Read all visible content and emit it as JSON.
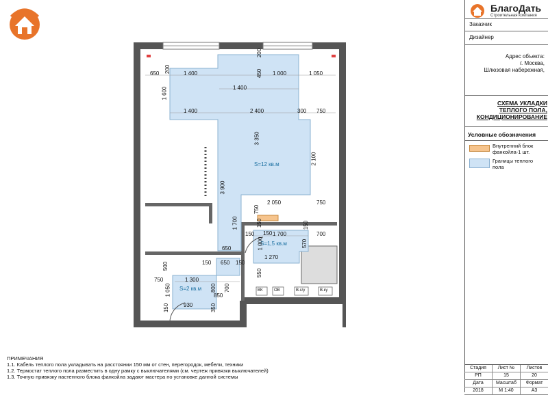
{
  "brand": {
    "name": "БлагоДать",
    "subtitle": "Строительная компания"
  },
  "title_block": {
    "customer_label": "Заказчик",
    "designer_label": "Дизайнер",
    "address": [
      "Адрес объекта:",
      "г. Москва,",
      "Шлюзовая набережная,"
    ],
    "sheet_title": [
      "СХЕМА УКЛАДКИ",
      "ТЕПЛОГО ПОЛА,",
      "КОНДИЦИОНИРОВАНИЕ"
    ],
    "legend_title": "Условные обозначения",
    "legend": [
      {
        "text": [
          "Внутренний блок",
          "фанкойла-1 шт."
        ],
        "color": "#f6c48d"
      },
      {
        "text": [
          "Границы теплого",
          "пола"
        ],
        "color": "#cfe3f5"
      }
    ]
  },
  "stamp": {
    "headers": [
      "Стадия",
      "Лист №",
      "Листов"
    ],
    "values": [
      "РП",
      "15",
      "20"
    ],
    "headers2": [
      "Дата",
      "Масштаб",
      "Формат"
    ],
    "values2": [
      "2018",
      "М 1:40",
      "А3"
    ]
  },
  "notes": {
    "title": "ПРИМЕЧАНИЯ",
    "items": [
      "1.1. Кабель теплого пола укладывать на расстоянии 150 мм от стен, перегородок, мебели, техники",
      "1.2. Термостат теплого пола разместить в одну рамку с выключателями (см. чертеж привязки выключателей)",
      "1.3. Точную привязку настенного блока фанкойла задают мастера по установке данной системы"
    ]
  },
  "plan": {
    "areas": [
      "S=12 кв.м",
      "S=1,5 кв.м",
      "S=2 кв.м"
    ],
    "dims": [
      "650",
      "1 400",
      "200",
      "450",
      "1 000",
      "1 050",
      "1 600",
      "1 400",
      "1 400",
      "2 400",
      "300",
      "750",
      "3 350",
      "2 100",
      "3 900",
      "2 050",
      "750",
      "750",
      "1 700",
      "150",
      "1 700",
      "700",
      "1 000",
      "570",
      "150",
      "650",
      "1 270",
      "500",
      "150",
      "650",
      "150",
      "1 300",
      "550",
      "750",
      "1 050",
      "800",
      "700",
      "850",
      "930",
      "150",
      "350",
      "150",
      "150",
      "200"
    ],
    "appliances": [
      "ВК",
      "ОВ",
      "В.с/у",
      "В.ку"
    ]
  }
}
